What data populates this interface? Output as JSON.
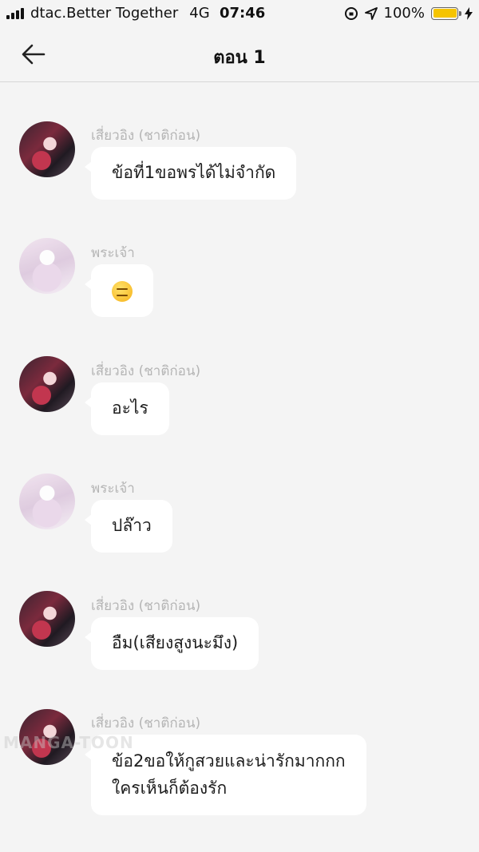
{
  "status_bar": {
    "carrier": "dtac.Better Together",
    "network": "4G",
    "time": "07:46",
    "battery_percent": "100%"
  },
  "nav": {
    "title": "ตอน 1"
  },
  "messages": [
    {
      "sender": "เสี่ยวอิง (ชาติก่อน)",
      "avatar": "dark",
      "lines": [
        "ข้อที่1ขอพรได้ไม่จำกัด"
      ]
    },
    {
      "sender": "พระเจ้า",
      "avatar": "light",
      "lines": [
        "😑"
      ]
    },
    {
      "sender": "เสี่ยวอิง (ชาติก่อน)",
      "avatar": "dark",
      "lines": [
        "อะไร"
      ]
    },
    {
      "sender": "พระเจ้า",
      "avatar": "light",
      "lines": [
        "ปล๊าว"
      ]
    },
    {
      "sender": "เสี่ยวอิง (ชาติก่อน)",
      "avatar": "dark",
      "lines": [
        "อืม(เสียงสูงนะมึง)"
      ]
    },
    {
      "sender": "เสี่ยวอิง (ชาติก่อน)",
      "avatar": "dark",
      "lines": [
        "ข้อ2ขอให้กูสวยและน่ารักมากกก",
        "ใครเห็นก็ต้องรัก"
      ]
    }
  ],
  "watermark": "MANGA-TOON"
}
